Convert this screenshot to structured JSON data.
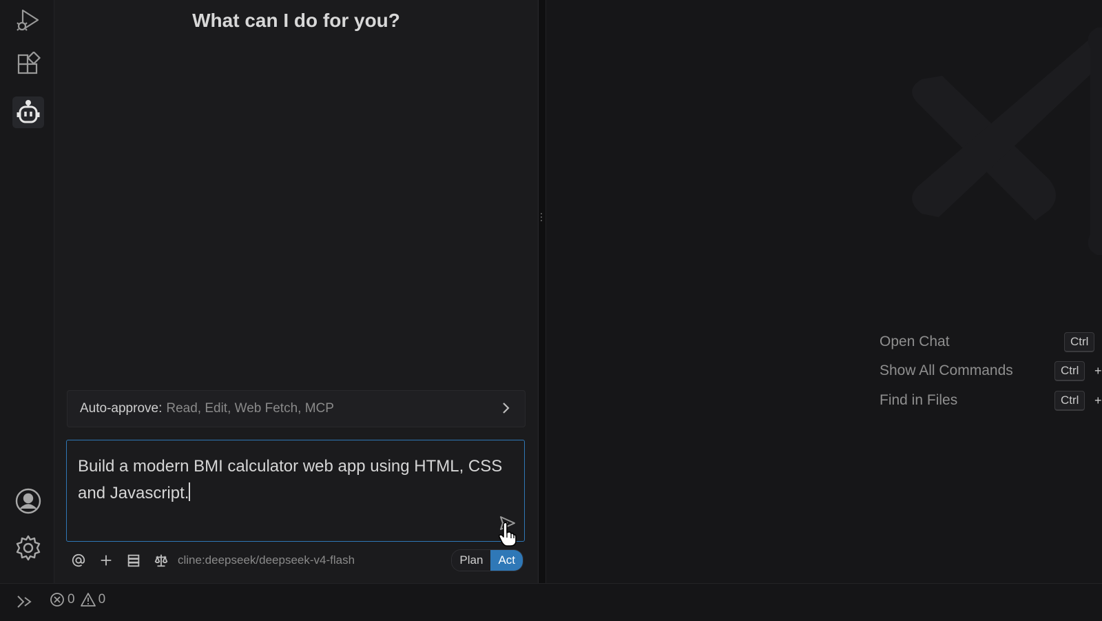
{
  "sidebar": {
    "title": "What can I do for you?",
    "auto_approve": {
      "label": "Auto-approve:",
      "value": "Read, Edit, Web Fetch, MCP"
    },
    "input": {
      "text": "Build a modern BMI calculator web app using HTML, CSS and Javascript."
    },
    "model": "cline:deepseek/deepseek-v4-flash",
    "modes": {
      "plan": "Plan",
      "act": "Act",
      "active": "Act"
    }
  },
  "activity_bar": {
    "icons": [
      "run-debug-icon",
      "extensions-icon",
      "cline-robot-icon",
      "account-icon",
      "settings-gear-icon"
    ]
  },
  "editor": {
    "shortcuts": [
      {
        "label": "Open Chat",
        "key": "Ctrl"
      },
      {
        "label": "Show All Commands",
        "key": "Ctrl",
        "plus": "+"
      },
      {
        "label": "Find in Files",
        "key": "Ctrl",
        "plus": "+"
      }
    ]
  },
  "statusbar": {
    "errors": "0",
    "warnings": "0"
  },
  "colors": {
    "accent": "#2f78b7",
    "background": "#1b1b1d"
  }
}
